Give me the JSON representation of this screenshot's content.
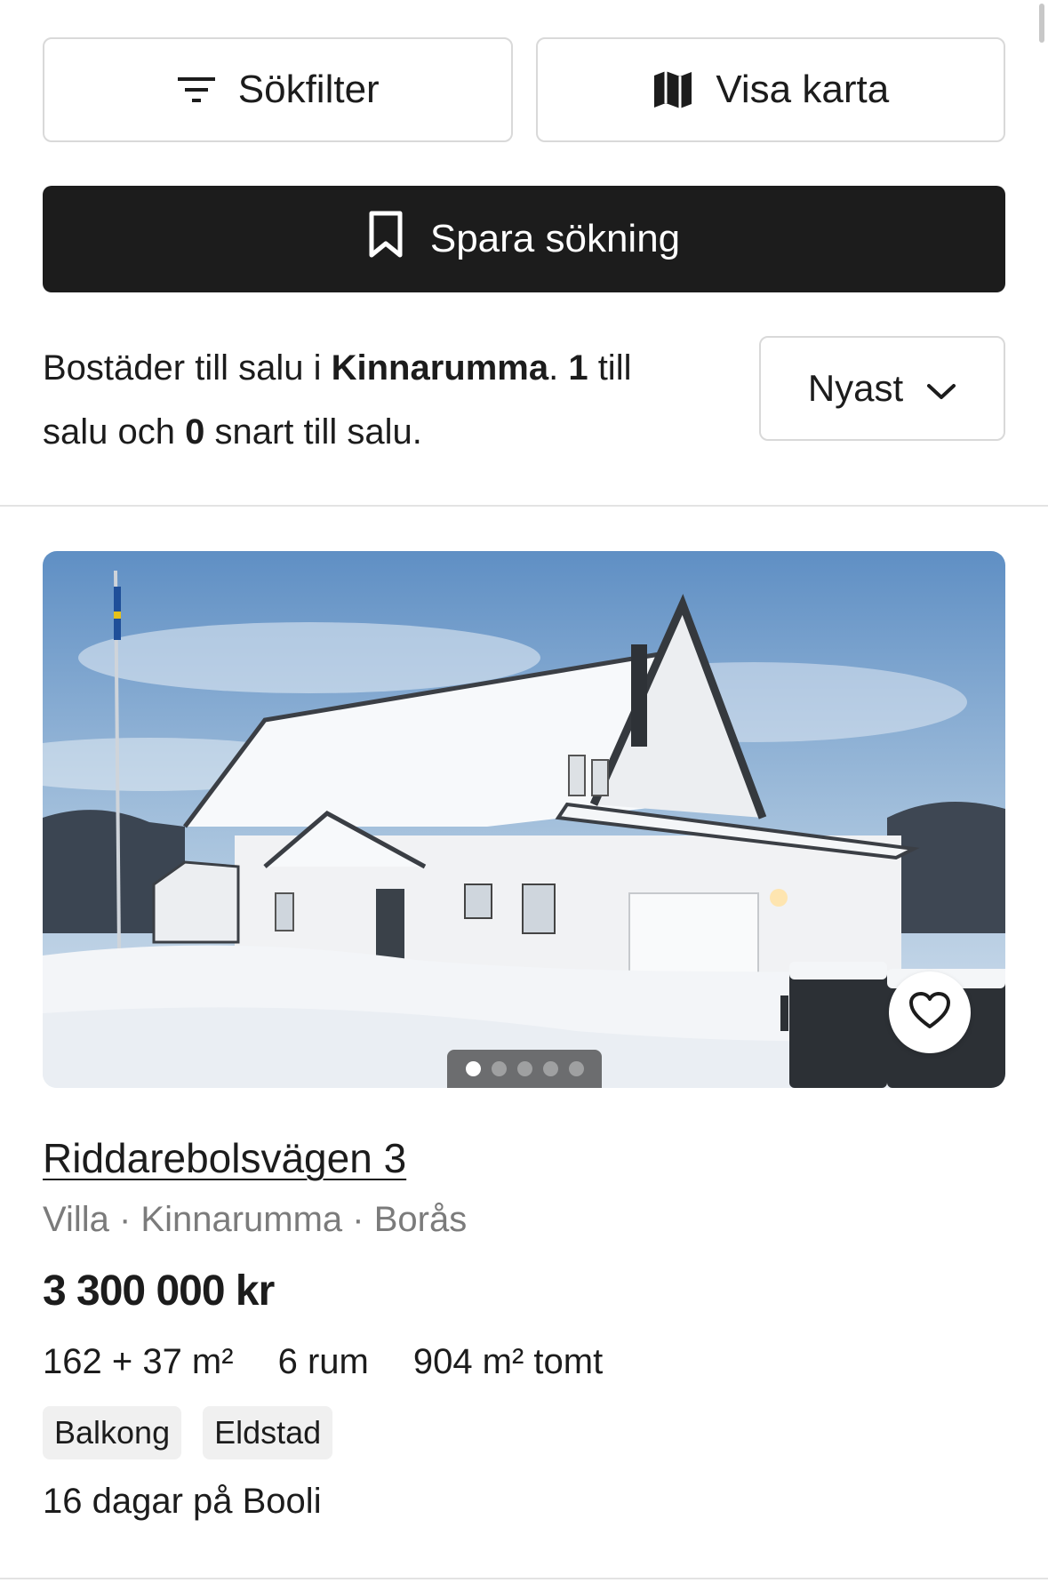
{
  "toolbar": {
    "filter_label": "Sökfilter",
    "map_label": "Visa karta",
    "save_search_label": "Spara sökning"
  },
  "summary": {
    "prefix": "Bostäder till salu i ",
    "area": "Kinnarumma",
    "sep": ". ",
    "for_sale_count": "1",
    "mid": " till salu och ",
    "coming_soon_count": "0",
    "suffix": " snart till salu."
  },
  "sort": {
    "selected": "Nyast"
  },
  "listing": {
    "address": "Riddarebolsvägen 3",
    "meta": "Villa · Kinnarumma · Borås",
    "price": "3 300 000 kr",
    "living_area": "162 + 37 m²",
    "rooms": "6 rum",
    "plot": "904 m² tomt",
    "tags": [
      "Balkong",
      "Eldstad"
    ],
    "days_on_site": "16 dagar på Booli",
    "image_count": 5,
    "active_image": 1,
    "image_alt": "snow-covered white house",
    "favorite_icon": "heart-icon"
  },
  "colors": {
    "primary_dark": "#1c1c1c",
    "border": "#d9d9d9",
    "muted_text": "#7b7b7b",
    "tag_bg": "#f0f0f0"
  }
}
